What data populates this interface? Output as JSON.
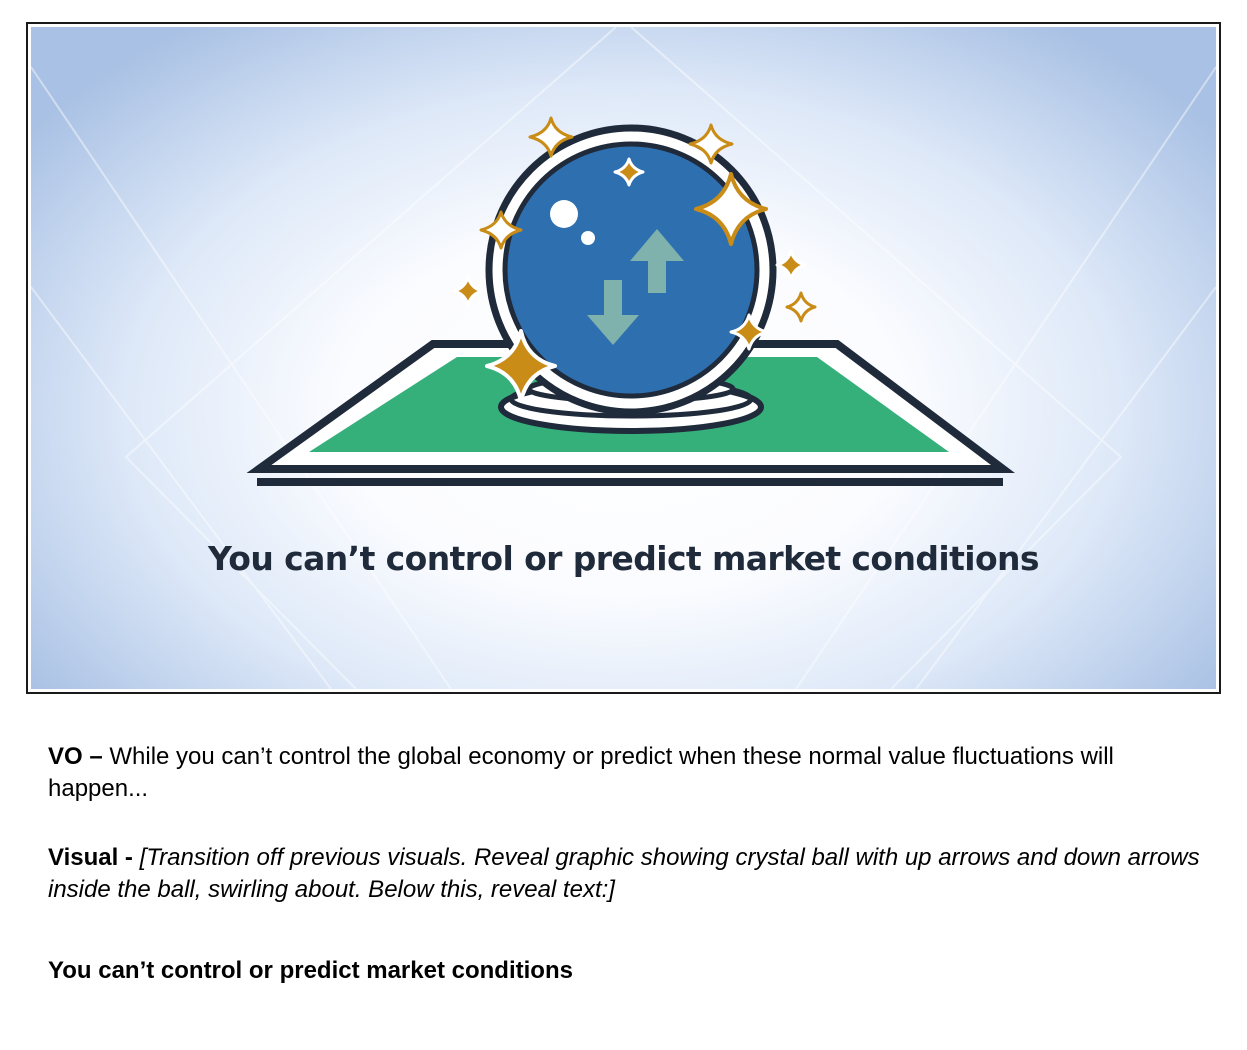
{
  "slide": {
    "caption": "You can’t control or predict market conditions",
    "colors": {
      "ball": "#2e6fb0",
      "arrows": "#7fb2ad",
      "mat": "#35b07a",
      "outline": "#1f2a3a",
      "sparkle": "#c98c16"
    },
    "icons": [
      "crystal-ball-icon",
      "up-arrow-icon",
      "down-arrow-icon",
      "sparkle-icon",
      "mat-icon"
    ]
  },
  "script": {
    "vo_label": "VO –",
    "vo_text": " While you can’t control the global economy or predict when these normal value fluctuations will happen...",
    "visual_label": "Visual -",
    "visual_text": " [Transition off previous visuals. Reveal graphic showing crystal ball with up arrows and down arrows inside the ball, swirling about. Below this, reveal text:]",
    "closing_text": "You can’t control or predict market conditions"
  }
}
